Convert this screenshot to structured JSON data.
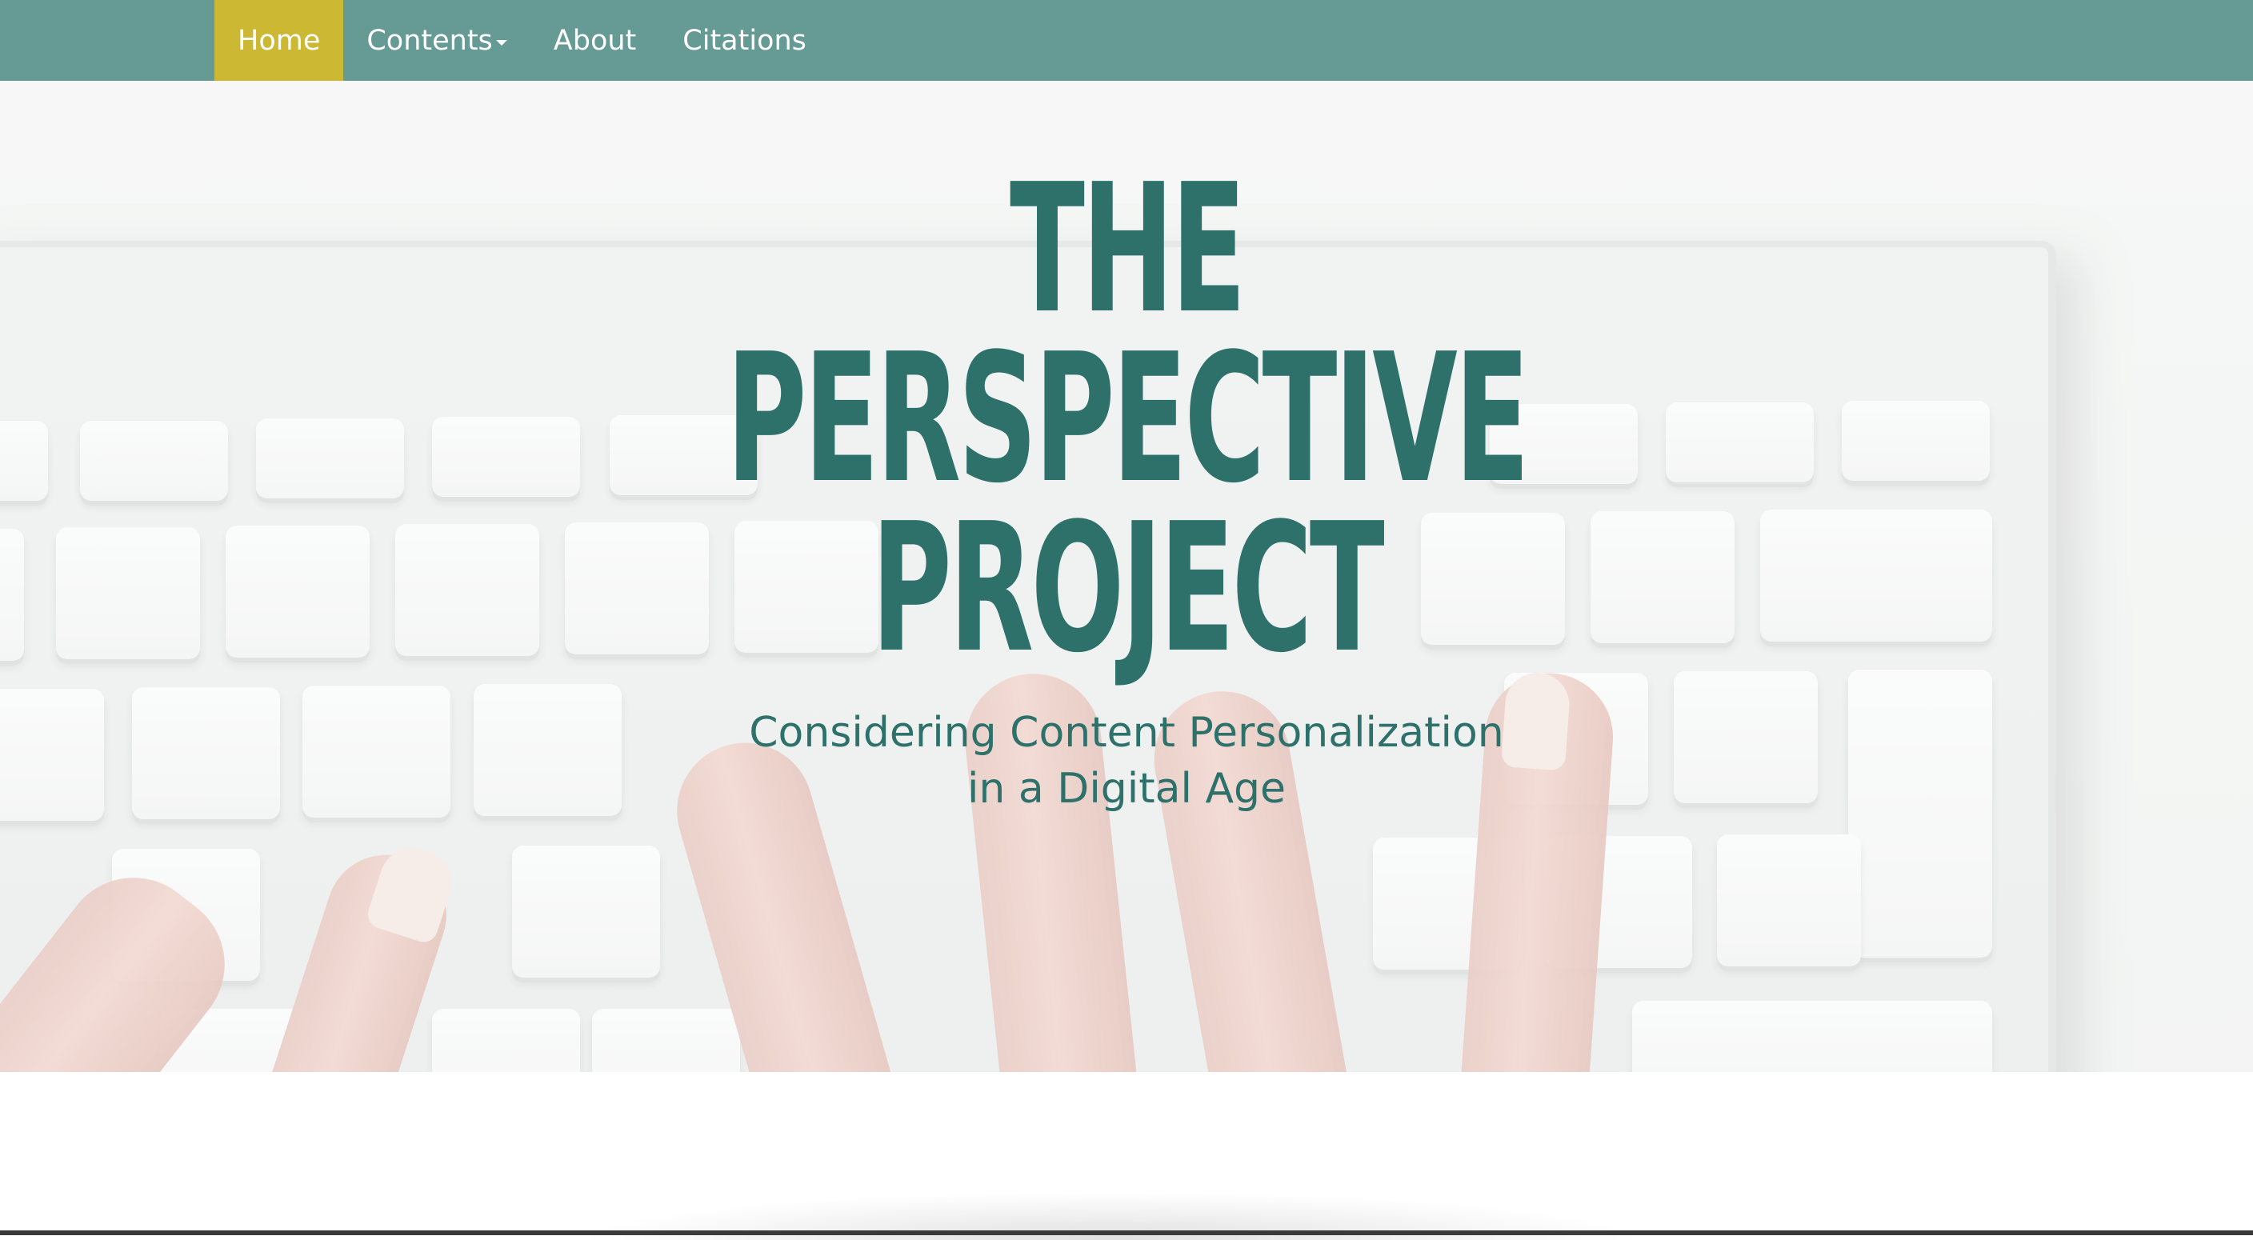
{
  "nav": {
    "items": [
      {
        "label": "Home",
        "active": true
      },
      {
        "label": "Contents",
        "dropdown": true
      },
      {
        "label": "About"
      },
      {
        "label": "Citations"
      }
    ]
  },
  "hero": {
    "title_line1": "THE",
    "title_line2": "PERSPECTIVE",
    "title_line3": "PROJECT",
    "subtitle_line1": "Considering Content Personalization",
    "subtitle_line2": "in a Digital Age"
  },
  "colors": {
    "nav_bg": "#669a94",
    "nav_active": "#cdb833",
    "title": "#2e716b"
  }
}
